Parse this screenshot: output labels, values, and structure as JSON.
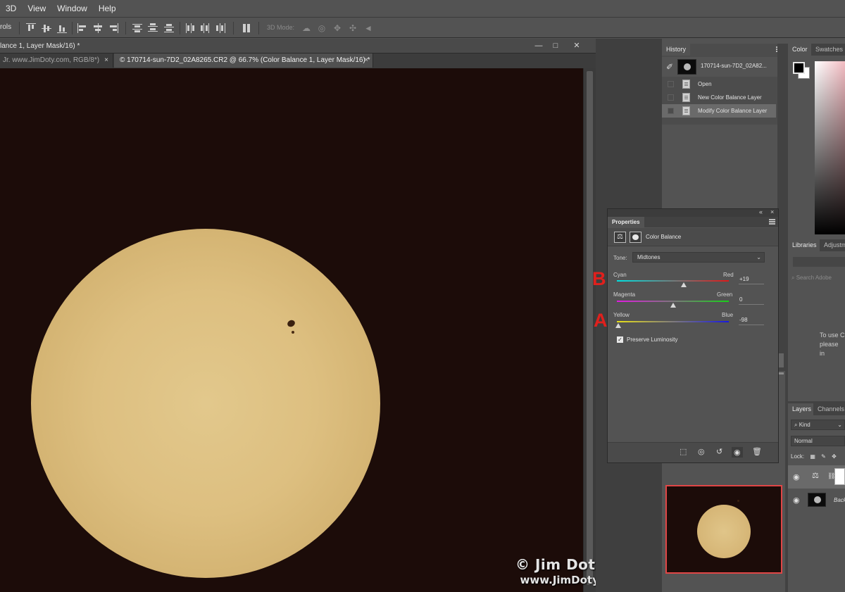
{
  "menu": [
    "3D",
    "View",
    "Window",
    "Help"
  ],
  "optionsbar": {
    "truncated_label": "rols",
    "mode_label": "3D Mode:",
    "icons_align": [
      "align-top-edges-icon",
      "align-vertical-centers-icon",
      "align-bottom-edges-icon",
      "align-left-edges-icon",
      "align-horizontal-centers-icon",
      "align-right-edges-icon",
      "distribute-top-icon",
      "distribute-vcenter-icon",
      "distribute-bottom-icon",
      "distribute-left-icon",
      "distribute-hcenter-icon",
      "distribute-right-icon",
      "auto-align-icon"
    ],
    "icons_3d": [
      "orbit-3d-icon",
      "roll-3d-icon",
      "drag-3d-icon",
      "slide-3d-icon",
      "scale-3d-icon"
    ]
  },
  "document": {
    "window_title": "lance 1, Layer Mask/16) *",
    "tabs": [
      {
        "label": "Jr. www.JimDoty.com, RGB/8*)",
        "active": false
      },
      {
        "label": "© 170714-sun-7D2_02A8265.CR2 @ 66.7% (Color Balance 1, Layer Mask/16) *",
        "active": true
      }
    ],
    "close_glyph": "×",
    "win_buttons": {
      "minimize": "—",
      "maximize": "□",
      "close": "✕"
    }
  },
  "watermark": {
    "line1": "© Jim Doty, Jr.",
    "line2": "www.JimDoty.com"
  },
  "history": {
    "tab": "History",
    "snapshot": "170714-sun-7D2_02A82...",
    "items": [
      "Open",
      "New Color Balance Layer",
      "Modify Color Balance Layer"
    ],
    "selected": 2
  },
  "colorpanel": {
    "tabs": [
      "Color",
      "Swatches"
    ],
    "fg_color": "#000000",
    "bg_color": "#ffffff"
  },
  "librariespanel": {
    "tabs": [
      "Libraries",
      "Adjustm"
    ],
    "search_placeholder": "Search Adobe",
    "message_lines": [
      "To use C",
      "please in"
    ]
  },
  "layerspanel": {
    "tabs": [
      "Layers",
      "Channels"
    ],
    "kind_label": "Kind",
    "blend_mode": "Normal",
    "lock_label": "Lock:",
    "layers": [
      {
        "name": "",
        "type": "adjustment",
        "selected": true
      },
      {
        "name": "Back",
        "type": "image",
        "selected": false
      }
    ]
  },
  "properties": {
    "title": "Properties",
    "header_controls": [
      "«",
      "×"
    ],
    "panel_name": "Color Balance",
    "tone_label": "Tone:",
    "tone_value": "Midtones",
    "sliders": [
      {
        "left": "Cyan",
        "right": "Red",
        "value": 19,
        "display": "+19"
      },
      {
        "left": "Magenta",
        "right": "Green",
        "value": 0,
        "display": "0"
      },
      {
        "left": "Yellow",
        "right": "Blue",
        "value": -98,
        "display": "-98"
      }
    ],
    "preserve_luminosity": {
      "label": "Preserve Luminosity",
      "checked": true
    },
    "footer_icons": [
      "clip-to-layer-icon",
      "view-previous-state-icon",
      "reset-icon",
      "visibility-eye-icon",
      "delete-trash-icon"
    ]
  },
  "annotations": {
    "b": "B",
    "a": "A"
  }
}
